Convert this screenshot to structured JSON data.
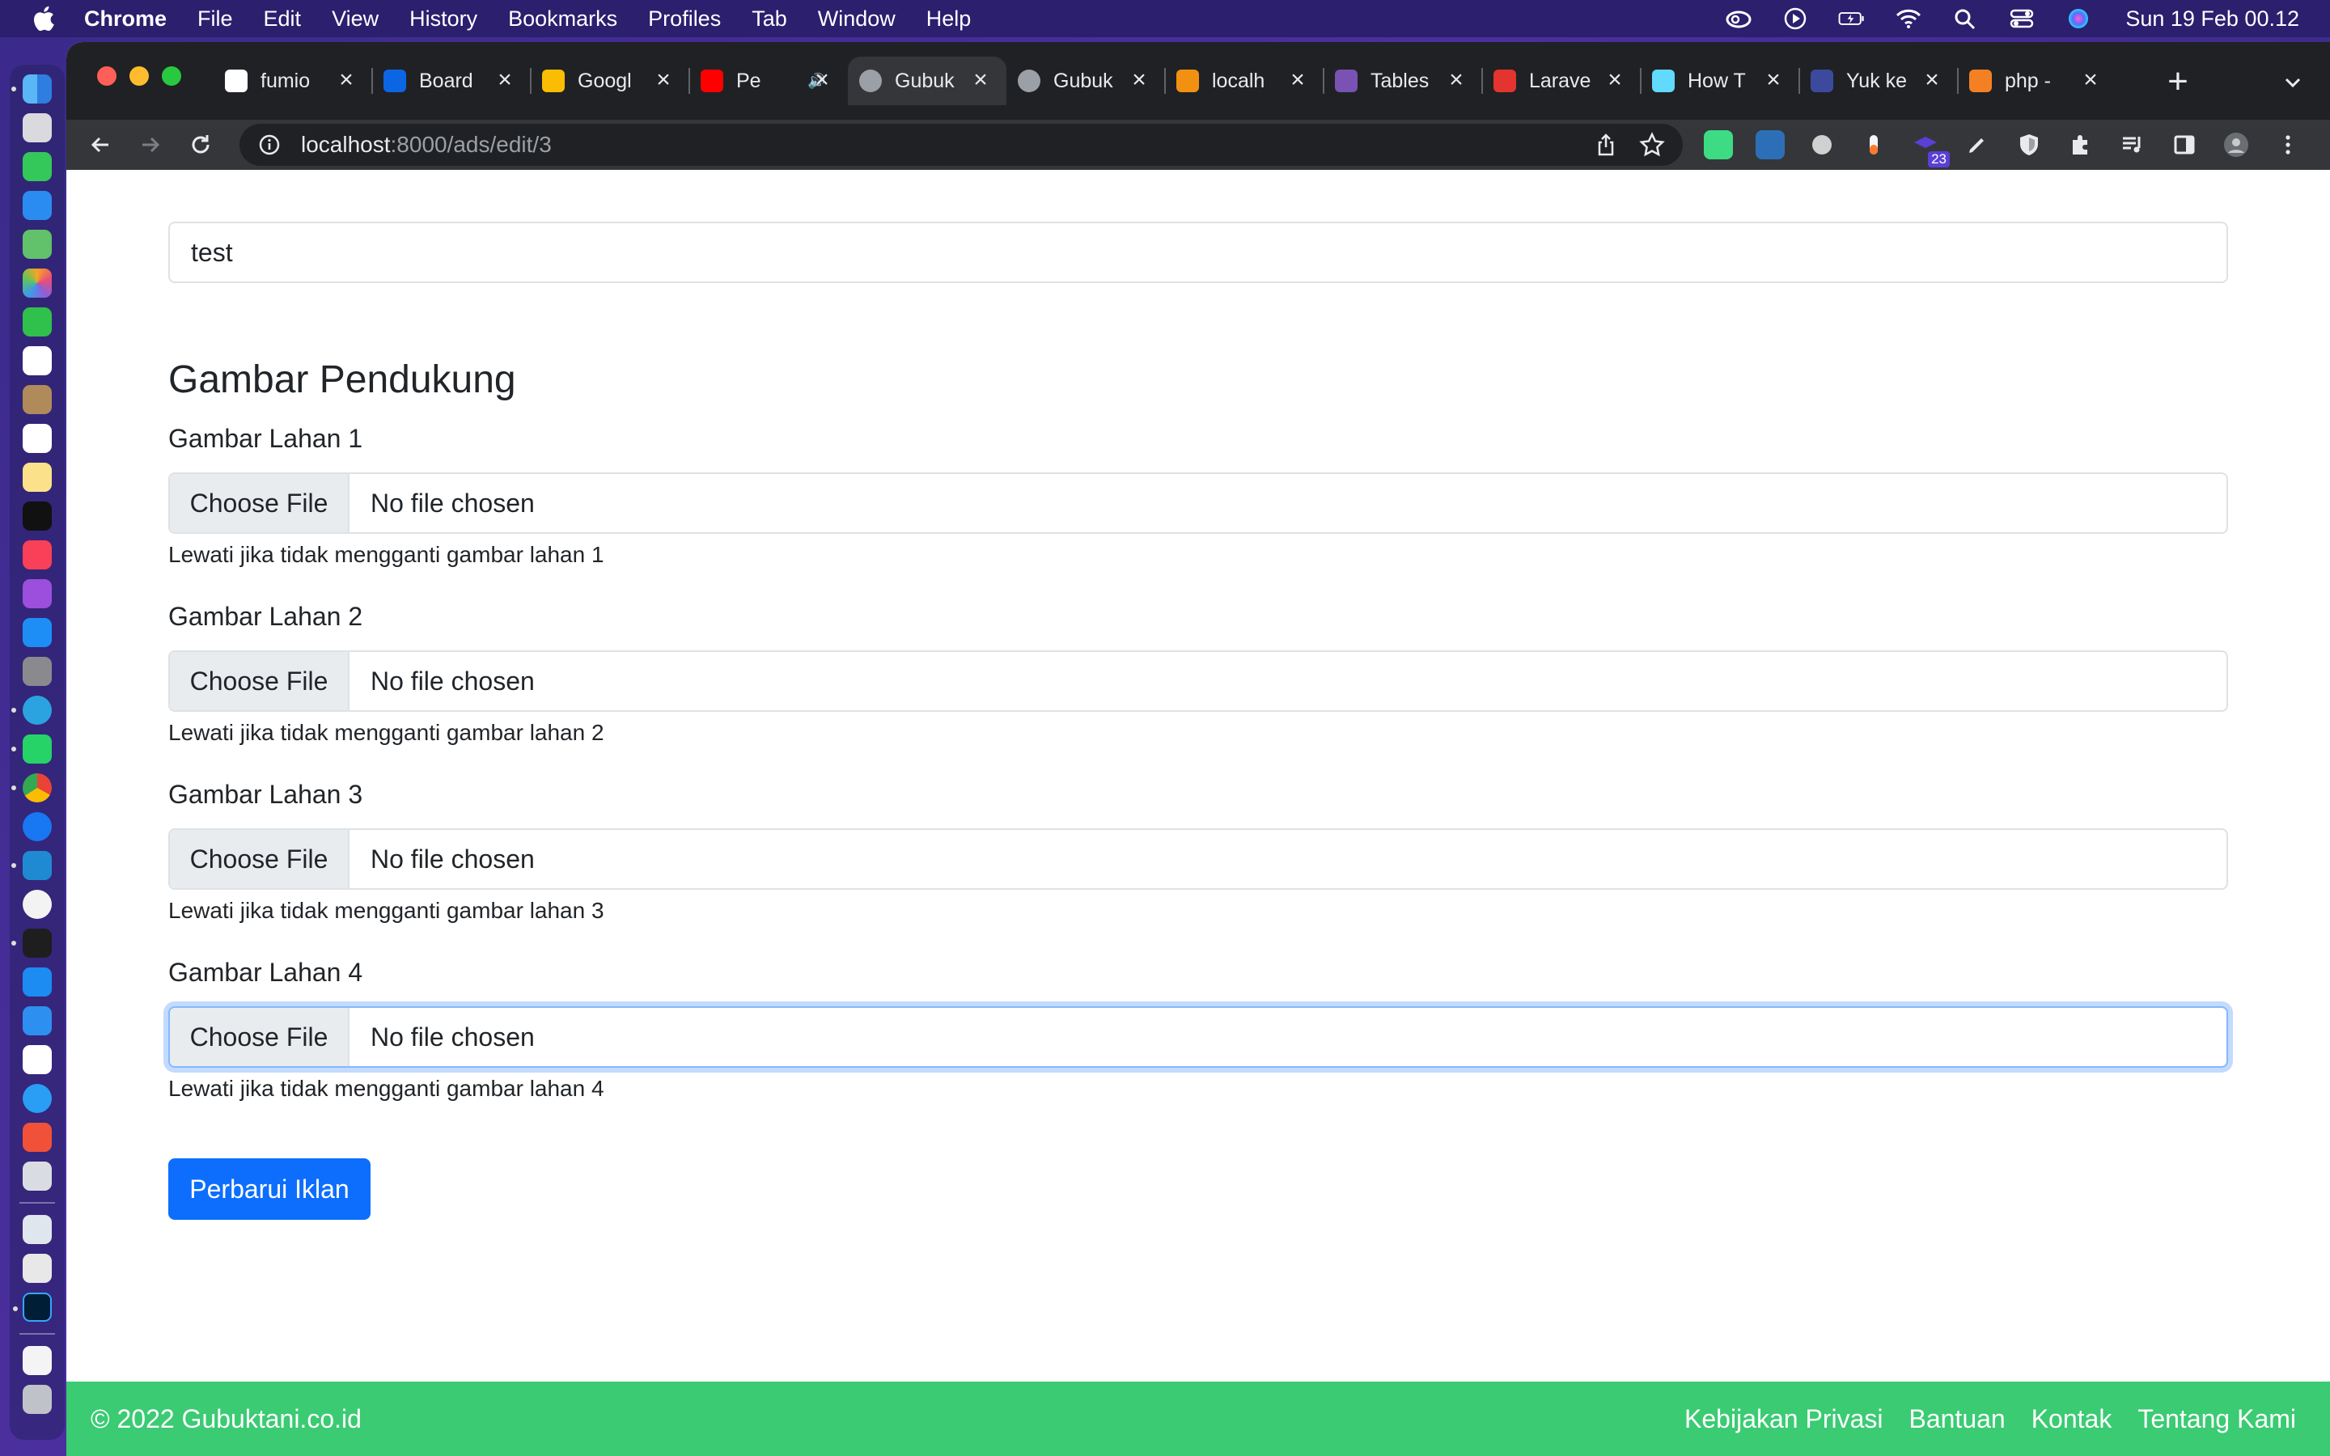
{
  "menubar": {
    "app": "Chrome",
    "items": [
      "File",
      "Edit",
      "View",
      "History",
      "Bookmarks",
      "Profiles",
      "Tab",
      "Window",
      "Help"
    ],
    "clock": "Sun 19 Feb  00.12"
  },
  "browser": {
    "tabs": [
      {
        "title": "fumio",
        "favicon": "google-icon",
        "color": "#ffffff"
      },
      {
        "title": "Board",
        "favicon": "trello-icon",
        "color": "#0c66e4"
      },
      {
        "title": "Googl",
        "favicon": "google-keep-icon",
        "color": "#fbbc04"
      },
      {
        "title": "Pe",
        "favicon": "youtube-icon",
        "color": "#ff0000"
      },
      {
        "title": "Gubuk",
        "favicon": "globe-icon",
        "color": "#9aa0a6"
      },
      {
        "title": "Gubuk",
        "favicon": "globe-icon",
        "color": "#9aa0a6"
      },
      {
        "title": "localh",
        "favicon": "phpmyadmin-icon",
        "color": "#f29111"
      },
      {
        "title": "Tables",
        "favicon": "bootstrap-icon",
        "color": "#7952b3"
      },
      {
        "title": "Larave",
        "favicon": "laravel-icon",
        "color": "#e3342f"
      },
      {
        "title": "How T",
        "favicon": "react-icon",
        "color": "#61dafb"
      },
      {
        "title": "Yuk ke",
        "favicon": "site-icon",
        "color": "#3c4a9e"
      },
      {
        "title": "php -",
        "favicon": "stackoverflow-icon",
        "color": "#f48024"
      }
    ],
    "url_host": "localhost",
    "url_path": ":8000/ads/edit/3",
    "extension_badge": "23"
  },
  "form": {
    "title_value": "test",
    "section_heading": "Gambar Pendukung",
    "file_button_label": "Choose File",
    "file_status": "No file chosen",
    "fields": [
      {
        "label": "Gambar Lahan 1",
        "help": "Lewati jika tidak mengganti gambar lahan 1"
      },
      {
        "label": "Gambar Lahan 2",
        "help": "Lewati jika tidak mengganti gambar lahan 2"
      },
      {
        "label": "Gambar Lahan 3",
        "help": "Lewati jika tidak mengganti gambar lahan 3"
      },
      {
        "label": "Gambar Lahan 4",
        "help": "Lewati jika tidak mengganti gambar lahan 4"
      }
    ],
    "submit_label": "Perbarui Iklan"
  },
  "footer": {
    "copyright": "© 2022 Gubuktani.co.id",
    "links": [
      "Kebijakan Privasi",
      "Bantuan",
      "Kontak",
      "Tentang Kami"
    ],
    "color": "#3bcb73"
  }
}
